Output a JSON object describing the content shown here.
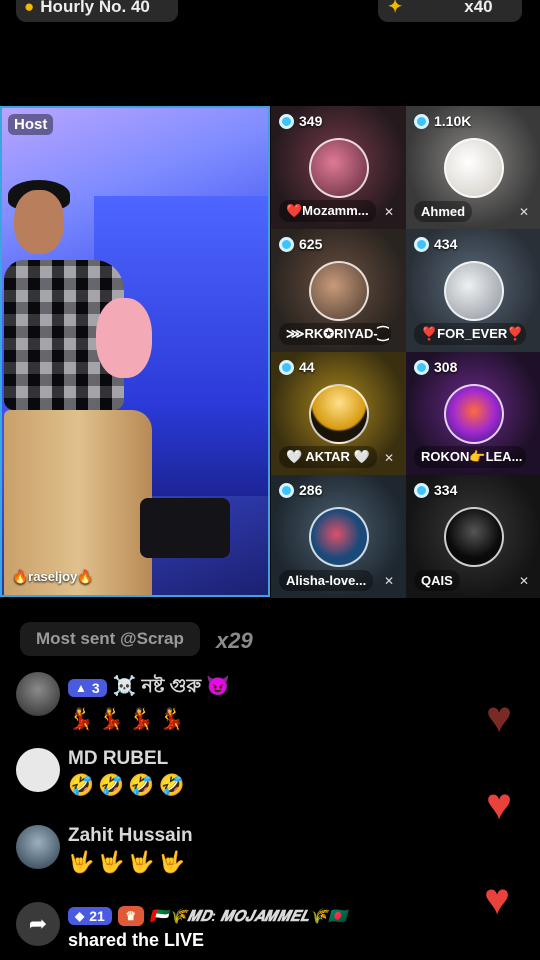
{
  "top": {
    "left_label": "Hourly No. 40",
    "right_label": "x40"
  },
  "host": {
    "tag": "Host",
    "name": "🔥raseljoy🔥"
  },
  "guests": [
    {
      "count": "349",
      "name": "❤️Mozamm...",
      "muted": true,
      "bg": "#3a2a2e",
      "avatar": "#b9566e"
    },
    {
      "count": "1.10K",
      "name": "Ahmed",
      "muted": true,
      "bg": "#5b5a5a",
      "avatar": "#e6e2da"
    },
    {
      "count": "625",
      "name": "⋙RK✪RIYAD-⁐",
      "muted": false,
      "bg": "#4a3a2c",
      "avatar": "#8a6a55"
    },
    {
      "count": "434",
      "name": "❣️FOR_EVER❣️",
      "muted": false,
      "bg": "#3e4a58",
      "avatar": "#c8ced6"
    },
    {
      "count": "44",
      "name": "🤍 AKTAR 🤍",
      "muted": true,
      "bg": "#6a5a1c",
      "avatar": "#d6a01c"
    },
    {
      "count": "308",
      "name": "ROKON👉LEA...",
      "muted": false,
      "bg": "#4a1e5a",
      "avatar": "#7a2ab0"
    },
    {
      "count": "286",
      "name": "Alisha-love...",
      "muted": true,
      "bg": "#3a4a58",
      "avatar": "#2a5a8a"
    },
    {
      "count": "334",
      "name": "QAIS",
      "muted": true,
      "bg": "#262626",
      "avatar": "#111111"
    }
  ],
  "chat": {
    "most_sent": "Most sent @Scrap",
    "multiplier": "x29",
    "messages": [
      {
        "level": "3",
        "name": "☠️ নষ্ট গুরু 😈",
        "text": "💃💃💃💃"
      },
      {
        "name": "MD RUBEL",
        "text": "🤣🤣🤣🤣"
      },
      {
        "name": "Zahit Hussain",
        "text": "🤟🤟🤟🤟"
      },
      {
        "level": "21",
        "name": "🇦🇪🌾𝑴𝑫: 𝑴𝑶𝑱𝑨𝑴𝑴𝑬𝑳🌾🇧🇩",
        "text": "shared the LIVE"
      }
    ]
  },
  "colors": {
    "accent": "#3aa6e0",
    "heart": "#e8423a",
    "heart_dim": "#7a2a25"
  }
}
